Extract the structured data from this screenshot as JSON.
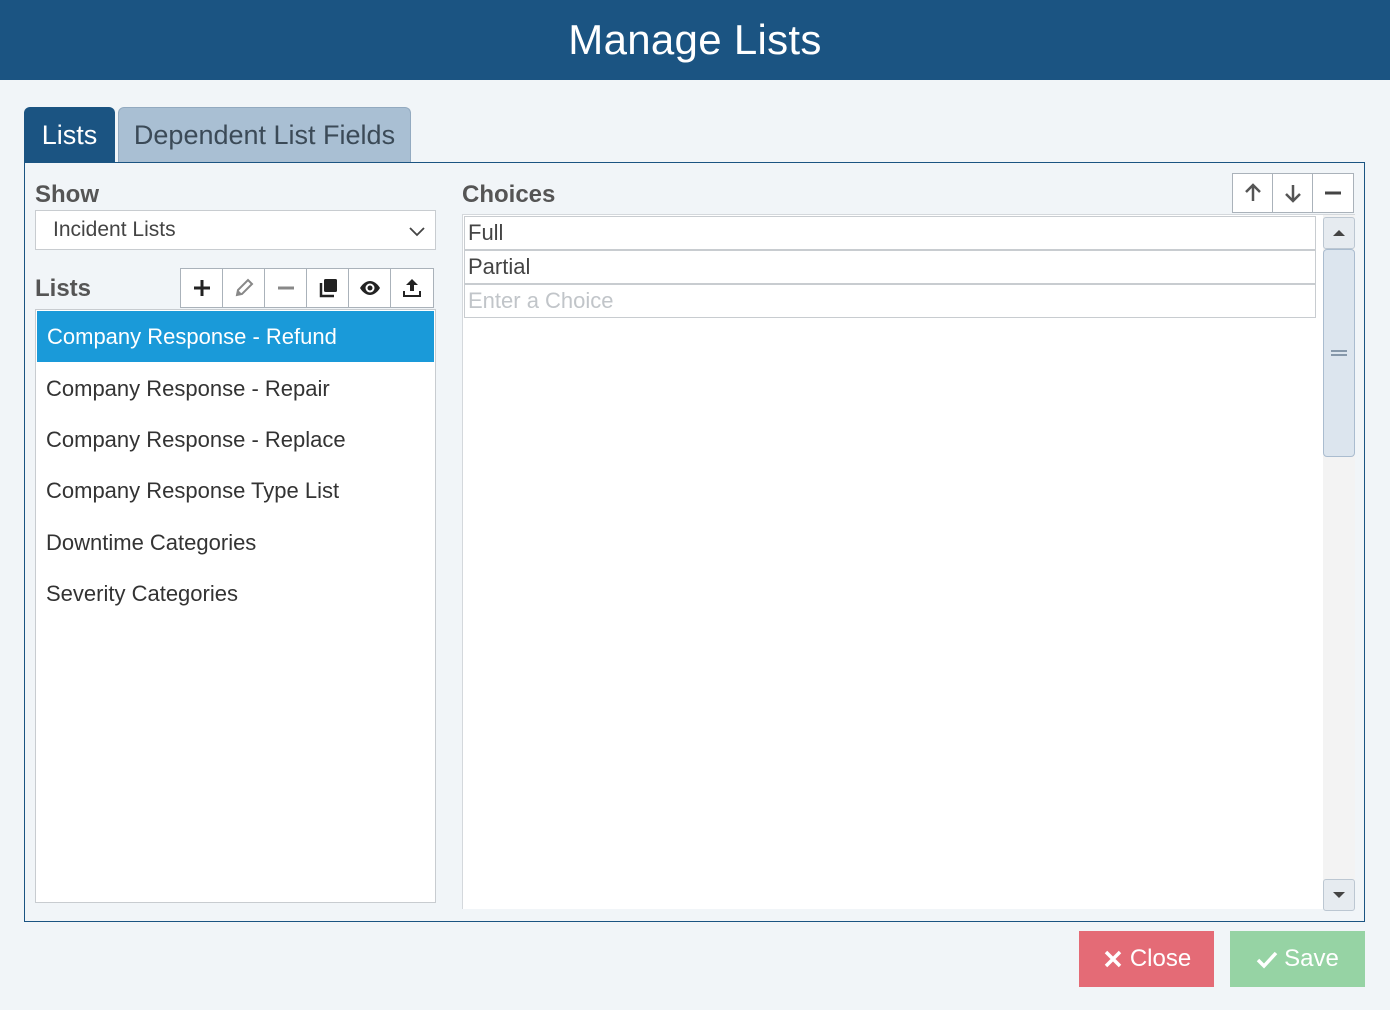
{
  "title": "Manage Lists",
  "tabs": [
    {
      "label": "Lists",
      "active": true
    },
    {
      "label": "Dependent List Fields",
      "active": false
    }
  ],
  "show": {
    "label": "Show",
    "selected": "Incident Lists"
  },
  "lists": {
    "label": "Lists",
    "toolbar": [
      "plus-icon",
      "pencil-icon",
      "minus-icon",
      "copy-icon",
      "eye-icon",
      "upload-icon"
    ],
    "items": [
      {
        "label": "Company Response - Refund",
        "selected": true
      },
      {
        "label": "Company Response - Repair",
        "selected": false
      },
      {
        "label": "Company Response - Replace",
        "selected": false
      },
      {
        "label": "Company Response Type List",
        "selected": false
      },
      {
        "label": "Downtime Categories",
        "selected": false
      },
      {
        "label": "Severity Categories",
        "selected": false
      }
    ]
  },
  "choices": {
    "label": "Choices",
    "toolbar": [
      "arrow-up-icon",
      "arrow-down-icon",
      "minus-icon"
    ],
    "items": [
      "Full",
      "Partial"
    ],
    "placeholder": "Enter a Choice"
  },
  "footer": {
    "close_label": "Close",
    "save_label": "Save"
  },
  "colors": {
    "header": "#1b5482",
    "selected": "#1a9ad9",
    "close": "#e46b76",
    "save": "#96d3a4"
  }
}
